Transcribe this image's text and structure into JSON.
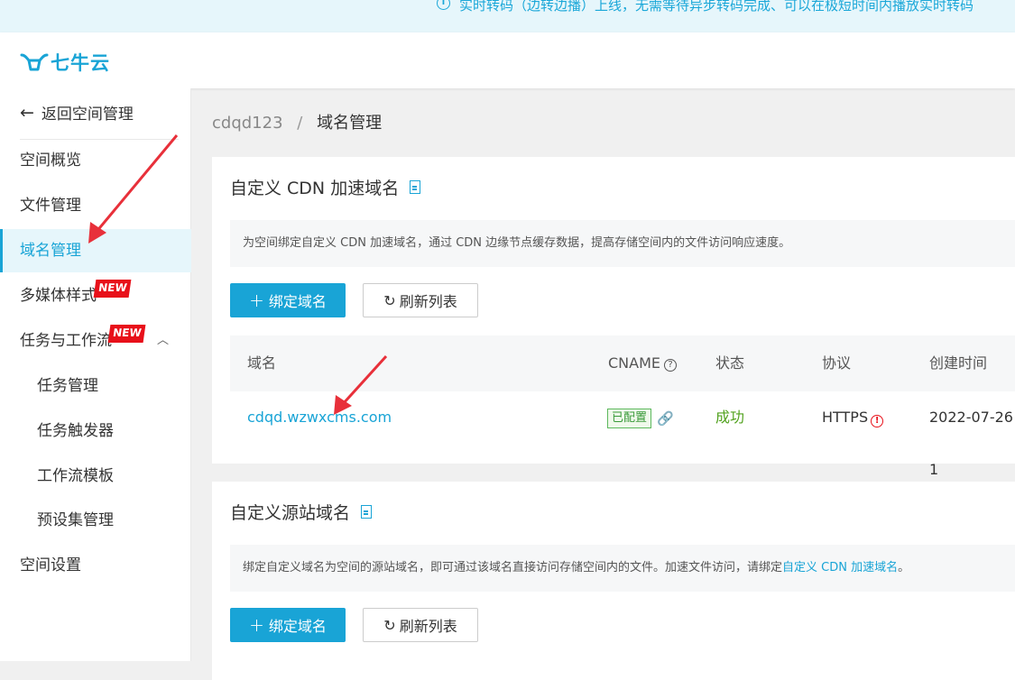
{
  "banner": {
    "text": "实时转码（边转边播）上线，无需等待异步转码完成、可以在极短时间内播放实时转码"
  },
  "header": {
    "logo_text": "七牛云"
  },
  "sidebar": {
    "back_label": "返回空间管理",
    "items": [
      {
        "label": "空间概览"
      },
      {
        "label": "文件管理"
      },
      {
        "label": "域名管理",
        "active": true
      },
      {
        "label": "多媒体样式",
        "badge": "NEW"
      },
      {
        "label": "任务与工作流",
        "badge": "NEW",
        "expanded": true
      },
      {
        "label": "任务管理",
        "sub": true
      },
      {
        "label": "任务触发器",
        "sub": true
      },
      {
        "label": "工作流模板",
        "sub": true
      },
      {
        "label": "预设集管理",
        "sub": true
      },
      {
        "label": "空间设置"
      }
    ]
  },
  "breadcrumb": {
    "bucket": "cdqd123",
    "separator": "/",
    "current": "域名管理"
  },
  "cdn_section": {
    "title": "自定义 CDN 加速域名",
    "description": "为空间绑定自定义 CDN 加速域名，通过 CDN 边缘节点缓存数据，提高存储空间内的文件访问响应速度。",
    "bind_button": "绑定域名",
    "refresh_button": "刷新列表",
    "columns": [
      "域名",
      "CNAME",
      "状态",
      "协议",
      "创建时间"
    ],
    "rows": [
      {
        "domain": "cdqd.wzwxcms.com",
        "cname_tag": "已配置",
        "status": "成功",
        "protocol": "HTTPS",
        "created": "2022-07-26 1"
      }
    ]
  },
  "origin_section": {
    "title": "自定义源站域名",
    "description": "绑定自定义域名为空间的源站域名，即可通过该域名直接访问存储空间内的文件。加速文件访问，请绑定",
    "description_link": "自定义 CDN 加速域名",
    "description_end": "。",
    "bind_button": "绑定域名",
    "refresh_button": "刷新列表"
  },
  "colors": {
    "accent": "#19a4d6",
    "badge_red": "#e8101a",
    "success": "#52a21f",
    "annotation_arrow": "#e8303a"
  }
}
